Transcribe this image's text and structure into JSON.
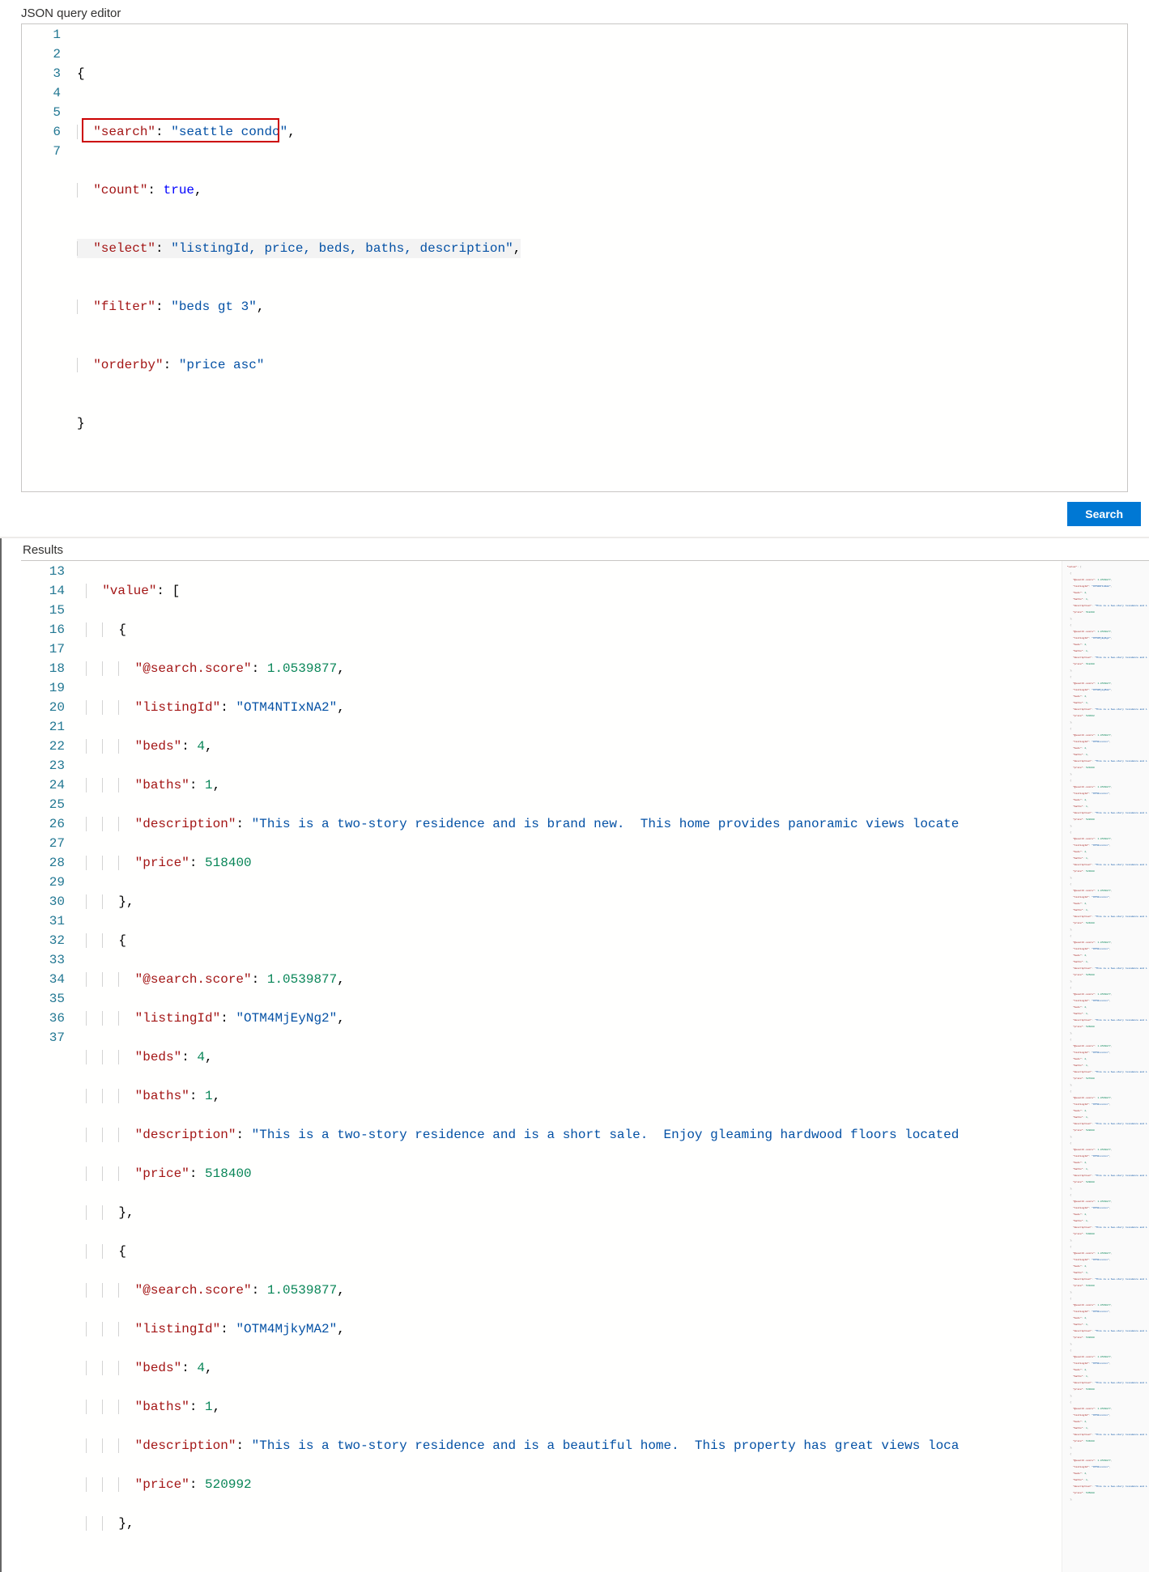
{
  "editor_label": "JSON query editor",
  "results_label": "Results",
  "search_button": "Search",
  "query": {
    "line_numbers": [
      "1",
      "2",
      "3",
      "4",
      "5",
      "6",
      "7"
    ],
    "search_key": "\"search\"",
    "search_val": "\"seattle condo\"",
    "count_key": "\"count\"",
    "count_val": "true",
    "select_key": "\"select\"",
    "select_val": "\"listingId, price, beds, baths, description\"",
    "filter_key": "\"filter\"",
    "filter_val": "\"beds gt 3\"",
    "orderby_key": "\"orderby\"",
    "orderby_val": "\"price asc\""
  },
  "results": {
    "line_numbers": [
      "13",
      "14",
      "15",
      "16",
      "17",
      "18",
      "19",
      "20",
      "21",
      "22",
      "23",
      "24",
      "25",
      "26",
      "27",
      "28",
      "29",
      "30",
      "31",
      "32",
      "33",
      "34",
      "35",
      "36",
      "37"
    ],
    "value_key": "\"value\"",
    "score_key": "\"@search.score\"",
    "listing_key": "\"listingId\"",
    "beds_key": "\"beds\"",
    "baths_key": "\"baths\"",
    "desc_key": "\"description\"",
    "price_key": "\"price\"",
    "r0": {
      "score": "1.0539877",
      "listing": "\"OTM4NTIxNA2\"",
      "beds": "4",
      "baths": "1",
      "desc": "\"This is a two-story residence and is brand new.  This home provides panoramic views locate",
      "price": "518400"
    },
    "r1": {
      "score": "1.0539877",
      "listing": "\"OTM4MjEyNg2\"",
      "beds": "4",
      "baths": "1",
      "desc": "\"This is a two-story residence and is a short sale.  Enjoy gleaming hardwood floors located",
      "price": "518400"
    },
    "r2": {
      "score": "1.0539877",
      "listing": "\"OTM4MjkyMA2\"",
      "beds": "4",
      "baths": "1",
      "desc": "\"This is a two-story residence and is a beautiful home.  This property has great views loca",
      "price": "520992"
    }
  }
}
